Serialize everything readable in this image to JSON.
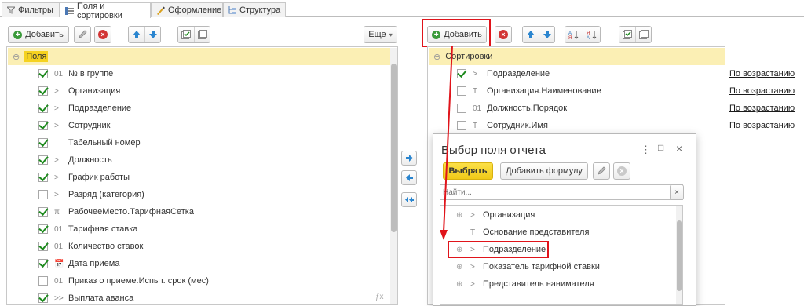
{
  "tabs": [
    {
      "label": "Фильтры",
      "icon": "filter-icon"
    },
    {
      "label": "Поля и сортировки",
      "icon": "fields-icon"
    },
    {
      "label": "Оформление",
      "icon": "brush-icon"
    },
    {
      "label": "Структура",
      "icon": "structure-icon"
    }
  ],
  "left_toolbar": {
    "add_label": "Добавить",
    "more_label": "Еще"
  },
  "left_tree": {
    "root_label": "Поля",
    "items": [
      {
        "checked": true,
        "prefix": "01",
        "label": "№ в группе"
      },
      {
        "checked": true,
        "prefix": ">",
        "label": "Организация"
      },
      {
        "checked": true,
        "prefix": ">",
        "label": "Подразделение"
      },
      {
        "checked": true,
        "prefix": ">",
        "label": "Сотрудник"
      },
      {
        "checked": true,
        "prefix": "",
        "label": "Табельный номер"
      },
      {
        "checked": true,
        "prefix": ">",
        "label": "Должность"
      },
      {
        "checked": true,
        "prefix": ">",
        "label": "График работы"
      },
      {
        "checked": false,
        "prefix": ">",
        "label": "Разряд (категория)"
      },
      {
        "checked": true,
        "prefix": "π",
        "label": "РабочееМесто.ТарифнаяСетка"
      },
      {
        "checked": true,
        "prefix": "01",
        "label": "Тарифная ставка"
      },
      {
        "checked": true,
        "prefix": "01",
        "label": "Количество ставок"
      },
      {
        "checked": true,
        "prefix": "📅",
        "label": "Дата приема"
      },
      {
        "checked": false,
        "prefix": "01",
        "label": "Приказ о приеме.Испыт. срок (мес)"
      },
      {
        "checked": true,
        "prefix": ">>",
        "label": "Выплата аванса"
      }
    ]
  },
  "right_toolbar": {
    "add_label": "Добавить"
  },
  "sort_tree": {
    "root_label": "Сортировки",
    "items": [
      {
        "checked": true,
        "prefix": ">",
        "label": "Подразделение",
        "order": "По возрастанию"
      },
      {
        "checked": false,
        "prefix": "T",
        "label": "Организация.Наименование",
        "order": "По возрастанию"
      },
      {
        "checked": false,
        "prefix": "01",
        "label": "Должность.Порядок",
        "order": "По возрастанию"
      },
      {
        "checked": false,
        "prefix": "T",
        "label": "Сотрудник.Имя",
        "order": "По возрастанию"
      }
    ]
  },
  "dialog": {
    "title": "Выбор поля отчета",
    "select_label": "Выбрать",
    "add_formula_label": "Добавить формулу",
    "search_placeholder": "Найти...",
    "items": [
      {
        "expand": "⊕",
        "prefix": ">",
        "label": "Организация"
      },
      {
        "expand": "",
        "prefix": "T",
        "label": "Основание представителя"
      },
      {
        "expand": "⊕",
        "prefix": ">",
        "label": "Подразделение"
      },
      {
        "expand": "⊕",
        "prefix": ">",
        "label": "Показатель тарифной ставки"
      },
      {
        "expand": "⊕",
        "prefix": ">",
        "label": "Представитель нанимателя"
      }
    ]
  },
  "colors": {
    "highlight": "#fbefb4",
    "accent_yellow": "#f5d21f",
    "annotation_red": "#e0141b",
    "check_green": "#1e8a1e"
  }
}
